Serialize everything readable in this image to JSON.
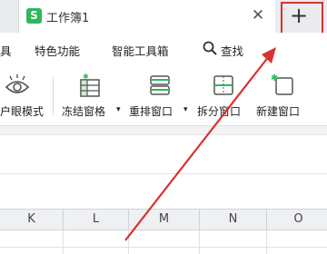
{
  "titlebar": {
    "tab": {
      "logo_letter": "S",
      "title": "工作簿1",
      "close_glyph": "✕"
    },
    "add_tab_glyph": "+"
  },
  "menu": {
    "items": [
      "具",
      "特色功能",
      "智能工具箱",
      "查找"
    ]
  },
  "ribbon": {
    "items": [
      {
        "label": "户眼模式",
        "icon": "eye-icon"
      },
      {
        "label": "冻结窗格",
        "icon": "freeze-panes-icon"
      },
      {
        "label": "重排窗口",
        "icon": "arrange-windows-icon"
      },
      {
        "label": "拆分窗口",
        "icon": "split-window-icon"
      },
      {
        "label": "新建窗口",
        "icon": "new-window-icon"
      }
    ]
  },
  "columns": [
    "K",
    "L",
    "M",
    "N",
    "O"
  ],
  "colors": {
    "highlight": "#d9322e",
    "brand": "#2eb75d"
  }
}
